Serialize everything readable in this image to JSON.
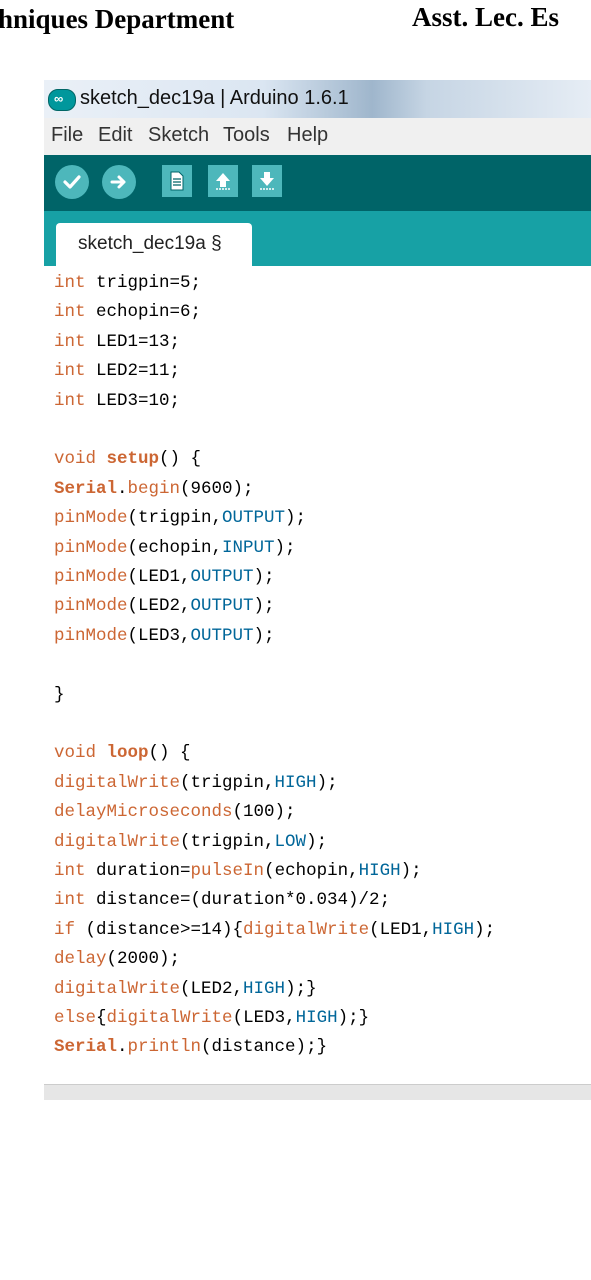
{
  "doc_header": {
    "left_text": "hniques Department",
    "right_text": "Asst. Lec. Es"
  },
  "window": {
    "title": "sketch_dec19a | Arduino 1.6.1",
    "app_icon_glyph": "∞",
    "menu": [
      "File",
      "Edit",
      "Sketch",
      "Tools",
      "Help"
    ],
    "toolbar": [
      "verify-icon",
      "upload-icon",
      "new-icon",
      "open-icon",
      "save-icon"
    ],
    "tab_label": "sketch_dec19a §",
    "colors": {
      "toolbar_bg": "#006468",
      "tabbar_bg": "#17a1a5",
      "button": "#4db7bb",
      "keyword": "#cc6633",
      "constant": "#006699"
    }
  },
  "code": {
    "lines": [
      [
        [
          "kw",
          "int"
        ],
        [
          "plain",
          " trigpin=5;"
        ]
      ],
      [
        [
          "kw",
          "int"
        ],
        [
          "plain",
          " echopin=6;"
        ]
      ],
      [
        [
          "kw",
          "int"
        ],
        [
          "plain",
          " LED1=13;"
        ]
      ],
      [
        [
          "kw",
          "int"
        ],
        [
          "plain",
          " LED2=11;"
        ]
      ],
      [
        [
          "kw",
          "int"
        ],
        [
          "plain",
          " LED3=10;"
        ]
      ],
      [],
      [
        [
          "kw",
          "void"
        ],
        [
          "plain",
          " "
        ],
        [
          "kwb",
          "setup"
        ],
        [
          "plain",
          "() {"
        ]
      ],
      [
        [
          "kwb",
          "Serial"
        ],
        [
          "plain",
          "."
        ],
        [
          "fn",
          "begin"
        ],
        [
          "plain",
          "(9600);"
        ]
      ],
      [
        [
          "fn",
          "pinMode"
        ],
        [
          "plain",
          "(trigpin,"
        ],
        [
          "const",
          "OUTPUT"
        ],
        [
          "plain",
          ");"
        ]
      ],
      [
        [
          "fn",
          "pinMode"
        ],
        [
          "plain",
          "(echopin,"
        ],
        [
          "const",
          "INPUT"
        ],
        [
          "plain",
          ");"
        ]
      ],
      [
        [
          "fn",
          "pinMode"
        ],
        [
          "plain",
          "(LED1,"
        ],
        [
          "const",
          "OUTPUT"
        ],
        [
          "plain",
          ");"
        ]
      ],
      [
        [
          "fn",
          "pinMode"
        ],
        [
          "plain",
          "(LED2,"
        ],
        [
          "const",
          "OUTPUT"
        ],
        [
          "plain",
          ");"
        ]
      ],
      [
        [
          "fn",
          "pinMode"
        ],
        [
          "plain",
          "(LED3,"
        ],
        [
          "const",
          "OUTPUT"
        ],
        [
          "plain",
          ");"
        ]
      ],
      [],
      [
        [
          "plain",
          "}"
        ]
      ],
      [],
      [
        [
          "kw",
          "void"
        ],
        [
          "plain",
          " "
        ],
        [
          "kwb",
          "loop"
        ],
        [
          "plain",
          "() {"
        ]
      ],
      [
        [
          "fn",
          "digitalWrite"
        ],
        [
          "plain",
          "(trigpin,"
        ],
        [
          "const",
          "HIGH"
        ],
        [
          "plain",
          ");"
        ]
      ],
      [
        [
          "fn",
          "delayMicroseconds"
        ],
        [
          "plain",
          "(100);"
        ]
      ],
      [
        [
          "fn",
          "digitalWrite"
        ],
        [
          "plain",
          "(trigpin,"
        ],
        [
          "const",
          "LOW"
        ],
        [
          "plain",
          ");"
        ]
      ],
      [
        [
          "kw",
          "int"
        ],
        [
          "plain",
          " duration="
        ],
        [
          "fn",
          "pulseIn"
        ],
        [
          "plain",
          "(echopin,"
        ],
        [
          "const",
          "HIGH"
        ],
        [
          "plain",
          ");"
        ]
      ],
      [
        [
          "kw",
          "int"
        ],
        [
          "plain",
          " distance=(duration*0.034)/2;"
        ]
      ],
      [
        [
          "kw",
          "if"
        ],
        [
          "plain",
          " (distance>=14){"
        ],
        [
          "fn",
          "digitalWrite"
        ],
        [
          "plain",
          "(LED1,"
        ],
        [
          "const",
          "HIGH"
        ],
        [
          "plain",
          ");"
        ]
      ],
      [
        [
          "fn",
          "delay"
        ],
        [
          "plain",
          "(2000);"
        ]
      ],
      [
        [
          "fn",
          "digitalWrite"
        ],
        [
          "plain",
          "(LED2,"
        ],
        [
          "const",
          "HIGH"
        ],
        [
          "plain",
          ");}"
        ]
      ],
      [
        [
          "kw",
          "else"
        ],
        [
          "plain",
          "{"
        ],
        [
          "fn",
          "digitalWrite"
        ],
        [
          "plain",
          "(LED3,"
        ],
        [
          "const",
          "HIGH"
        ],
        [
          "plain",
          ");}"
        ]
      ],
      [
        [
          "kwb",
          "Serial"
        ],
        [
          "plain",
          "."
        ],
        [
          "fn",
          "println"
        ],
        [
          "plain",
          "(distance);}"
        ]
      ]
    ]
  }
}
